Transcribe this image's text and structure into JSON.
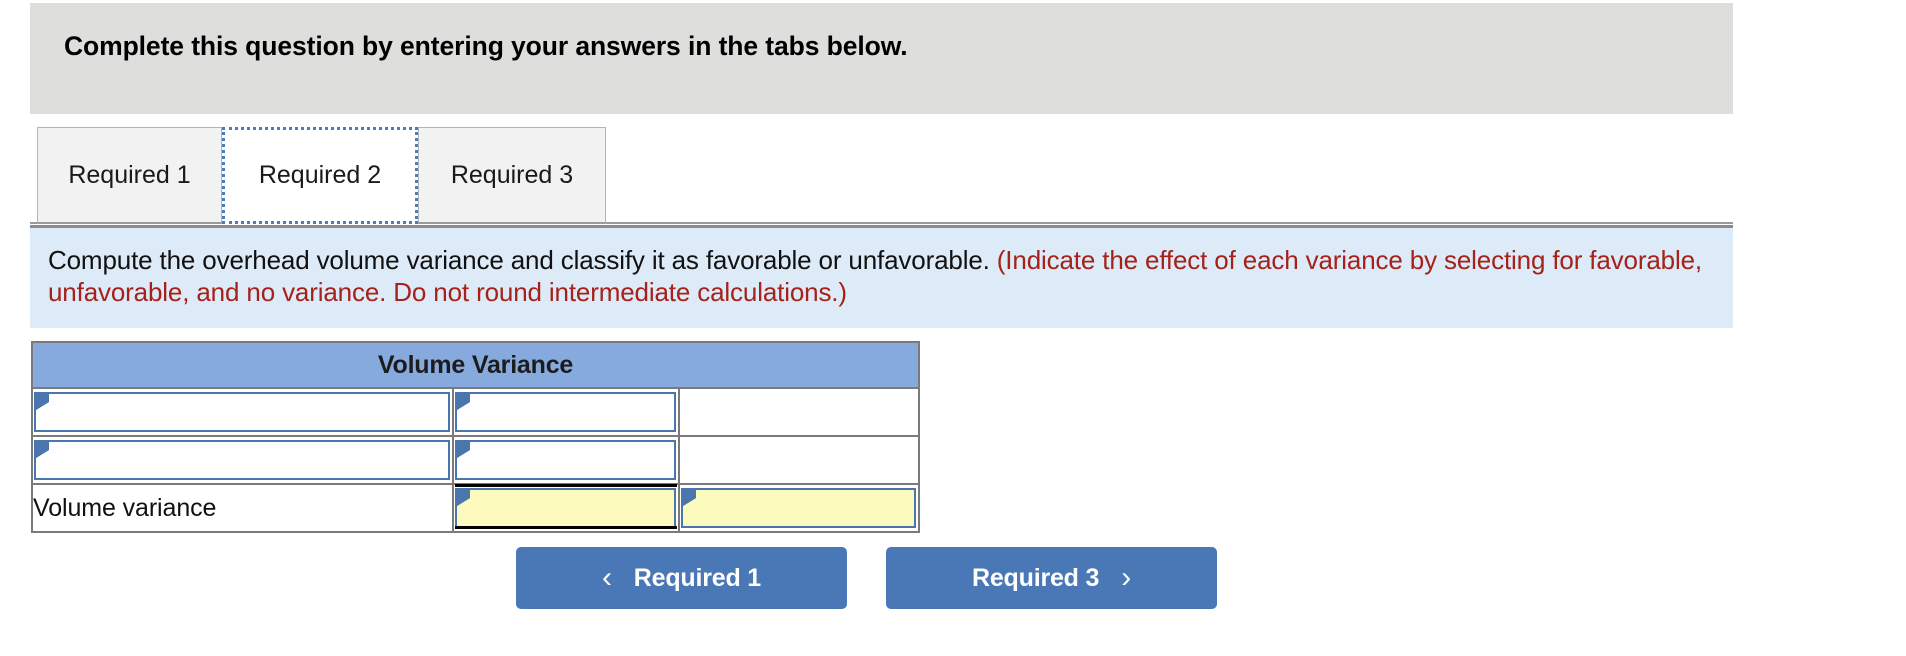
{
  "banner": {
    "heading": "Complete this question by entering your answers in the tabs below."
  },
  "tabs": {
    "items": [
      {
        "label": "Required 1",
        "active": false
      },
      {
        "label": "Required 2",
        "active": true
      },
      {
        "label": "Required 3",
        "active": false
      }
    ]
  },
  "prompt": {
    "main": "Compute the overhead volume variance and classify it as favorable or unfavorable. ",
    "note": "(Indicate the effect of each variance by selecting for favorable, unfavorable, and no variance. Do not round intermediate calculations.)"
  },
  "table": {
    "header": "Volume Variance",
    "rows": [
      {
        "label_value": "",
        "mid_value": "",
        "right_value": "",
        "label_type": "dropdown",
        "mid_type": "dropdown",
        "right_type": "blank"
      },
      {
        "label_value": "",
        "mid_value": "",
        "right_value": "",
        "label_type": "dropdown",
        "mid_type": "dropdown",
        "right_type": "blank"
      },
      {
        "label_value": "Volume variance",
        "mid_value": "",
        "right_value": "",
        "label_type": "text",
        "mid_type": "dropdown-total",
        "right_type": "dropdown"
      }
    ]
  },
  "nav": {
    "prev_label": "Required 1",
    "next_label": "Required 3",
    "prev_icon": "chevron-left-icon",
    "next_icon": "chevron-right-icon",
    "prev_glyph": "‹",
    "next_glyph": "›"
  },
  "colors": {
    "banner_bg": "#dededd",
    "prompt_bg": "#ddeaf7",
    "prompt_note": "#a52119",
    "table_header_bg": "#87aade",
    "field_border": "#4a76ad",
    "field_highlight": "#fcfbbd",
    "button_bg": "#4a77b5",
    "tab_focus": "#4a7ebb"
  }
}
